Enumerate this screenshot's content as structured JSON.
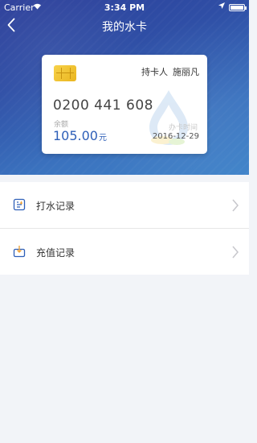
{
  "status_bar": {
    "carrier": "Carrier",
    "time": "3:34 PM"
  },
  "nav": {
    "title": "我的水卡",
    "back_icon": "chevron-left-icon"
  },
  "card": {
    "holder_label": "持卡人",
    "holder_name": "施丽凡",
    "card_number": "0200 441 608",
    "balance_label": "余额",
    "balance_value": "105.00",
    "balance_unit": "元",
    "date_label": "办卡时间",
    "date_value": "2016-12-29"
  },
  "menu": {
    "items": [
      {
        "label": "打水记录",
        "icon": "water-record-icon"
      },
      {
        "label": "充值记录",
        "icon": "recharge-record-icon"
      }
    ]
  },
  "colors": {
    "header_gradient_start": "#2d3f9a",
    "header_gradient_end": "#3f83c9",
    "accent_blue": "#2e5fb8",
    "chip_gold": "#f0c232",
    "page_background": "#f2f4f8"
  }
}
